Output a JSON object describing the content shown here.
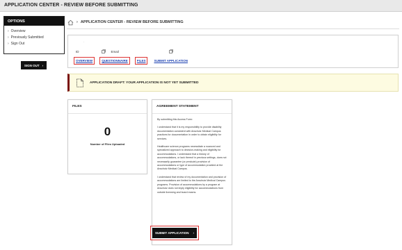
{
  "app": {
    "title": "APPLICATION CENTER - REVIEW BEFORE SUBMITTING"
  },
  "sidebar": {
    "heading": "OPTIONS",
    "items": [
      {
        "label": "Overview"
      },
      {
        "label": "Previously Submitted"
      },
      {
        "label": "Sign Out"
      }
    ],
    "signout_label": "SIGN OUT"
  },
  "breadcrumb": {
    "label": "APPLICATION CENTER - REVIEW BEFORE SUBMITTING"
  },
  "info": {
    "dot": "·",
    "id_label": "ID",
    "email_label": "Email"
  },
  "tabs": [
    {
      "label": "OVERVIEW"
    },
    {
      "label": "QUESTIONNAIRE"
    },
    {
      "label": "FILES"
    },
    {
      "label": "SUBMIT APPLICATION"
    }
  ],
  "banner": {
    "message": "APPLICATION DRAFT: YOUR APPLICATION IS NOT YET SUBMITTED"
  },
  "files": {
    "title": "FILES",
    "count": "0",
    "caption": "Number of Files Uploaded"
  },
  "agreement": {
    "title": "AGREEMENT STATEMENT",
    "paragraphs": [
      "By submitting this Access Form:",
      "I understand that it is my responsibility to provide disability documentation consistent with Anschutz Medical Campus practices for documentation in order to obtain eligibility for services.",
      "Healthcare science programs necessitate a nuanced and specialized approach to decision-making and eligibility for accommodations. I understand that a history of accommodations, or lack thereof in previous settings, does not necessarily guarantee (or preclude) provision of accommodations or type of accommodation provided at the Anschutz Medical Campus.",
      "I understand that review of my documentation and provision of accommodations are limited to the Anschutz Medical Campus programs. Provision of accommodations by a program at Anschutz does not imply eligibility for accommodations from outside licensing and board exams."
    ]
  },
  "submit": {
    "label": "SUBMIT APPLICATION"
  },
  "colors": {
    "accent": "#7a1010",
    "tab_link": "#1a3fb0",
    "highlight": "#dd3333",
    "banner_bg": "#fdfbe1"
  }
}
